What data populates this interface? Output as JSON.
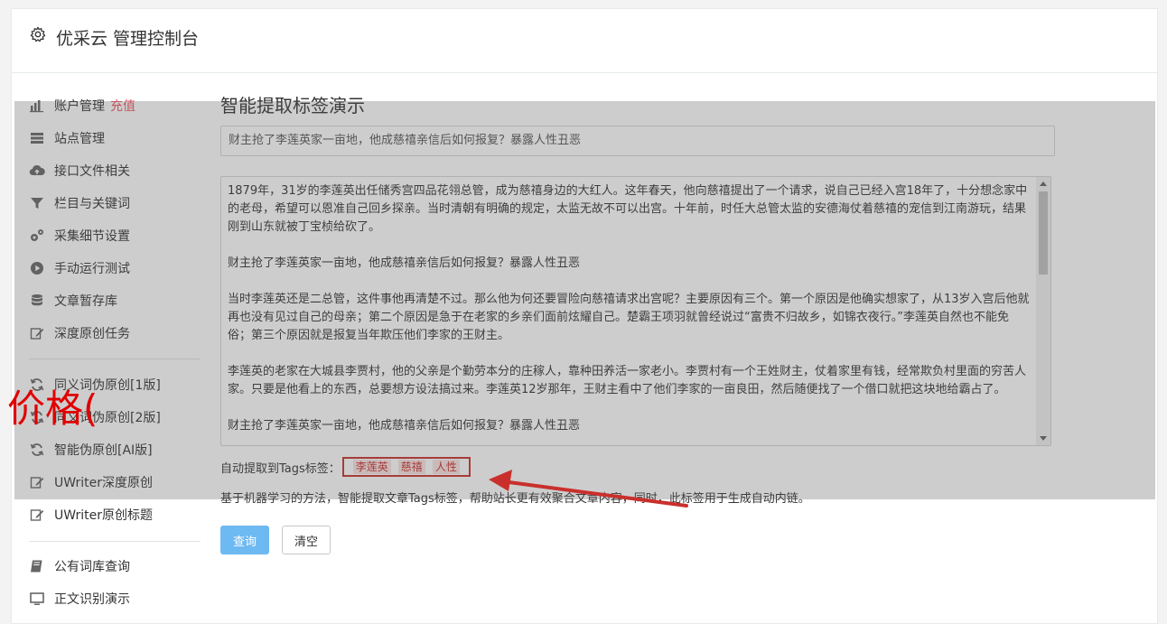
{
  "header": {
    "title": "优采云 管理控制台"
  },
  "sidebar": {
    "items": [
      {
        "label": "账户管理",
        "highlight": "充值"
      },
      {
        "label": "站点管理"
      },
      {
        "label": "接口文件相关"
      },
      {
        "label": "栏目与关键词"
      },
      {
        "label": "采集细节设置"
      },
      {
        "label": "手动运行测试"
      },
      {
        "label": "文章暂存库"
      },
      {
        "label": "深度原创任务"
      },
      {
        "label": "同义词伪原创[1版]"
      },
      {
        "label": "同义词伪原创[2版]"
      },
      {
        "label": "智能伪原创[AI版]"
      },
      {
        "label": "UWriter深度原创"
      },
      {
        "label": "UWriter原创标题"
      },
      {
        "label": "公有词库查询"
      },
      {
        "label": "正文识别演示"
      }
    ]
  },
  "main": {
    "page_title": "智能提取标签演示",
    "title_input": {
      "value": "财主抢了李莲英家一亩地，他成慈禧亲信后如何报复？暴露人性丑恶"
    },
    "content_paragraphs": [
      "1879年，31岁的李莲英出任储秀宫四品花翎总管，成为慈禧身边的大红人。这年春天，他向慈禧提出了一个请求，说自己已经入宫18年了，十分想念家中的老母，希望可以恩准自己回乡探亲。当时清朝有明确的规定，太监无故不可以出宫。十年前，时任大总管太监的安德海仗着慈禧的宠信到江南游玩，结果刚到山东就被丁宝桢给砍了。",
      "财主抢了李莲英家一亩地，他成慈禧亲信后如何报复？暴露人性丑恶",
      "当时李莲英还是二总管，这件事他再清楚不过。那么他为何还要冒险向慈禧请求出宫呢？主要原因有三个。第一个原因是他确实想家了，从13岁入宫后他就再也没有见过自己的母亲；第二个原因是急于在老家的乡亲们面前炫耀自己。楚霸王项羽就曾经说过“富贵不归故乡，如锦衣夜行。”李莲英自然也不能免俗；第三个原因就是报复当年欺压他们李家的王财主。",
      "李莲英的老家在大城县李贾村，他的父亲是个勤劳本分的庄稼人，靠种田养活一家老小。李贾村有一个王姓财主，仗着家里有钱，经常欺负村里面的穷苦人家。只要是他看上的东西，总要想方设法搞过来。李莲英12岁那年，王财主看中了他们李家的一亩良田，然后随便找了一个借口就把这块地给霸占了。",
      "财主抢了李莲英家一亩地，他成慈禧亲信后如何报复？暴露人性丑恶"
    ],
    "tags_label": "自动提取到Tags标签：",
    "tags": [
      "李莲英",
      "慈禧",
      "人性"
    ],
    "description": "基于机器学习的方法，智能提取文章Tags标签，帮助站长更有效聚合文章内容，同时，此标签用于生成自动内链。",
    "query_button": "查询",
    "clear_button": "清空"
  },
  "annotation": {
    "price_text": "价格("
  },
  "colors": {
    "accent": "#6db9f2",
    "highlight_red": "#ed5565",
    "annotation_red": "#c9302c"
  }
}
